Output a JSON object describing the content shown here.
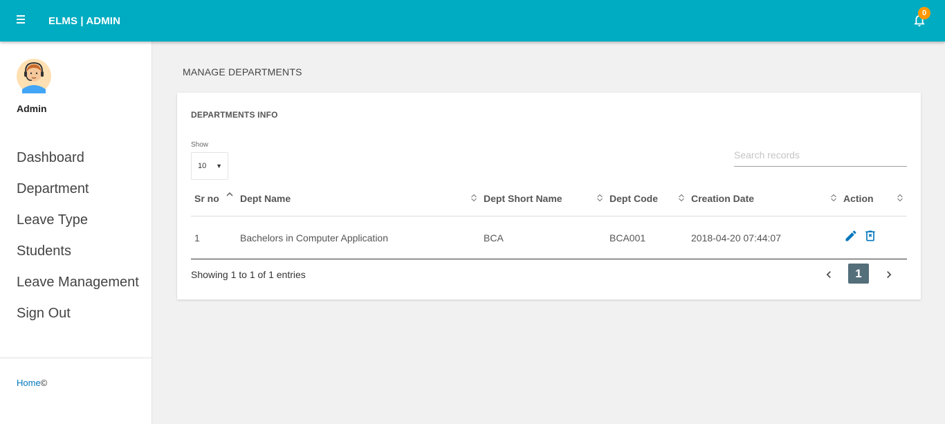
{
  "header": {
    "brand": "ELMS | ADMIN",
    "notification_count": "0"
  },
  "sidebar": {
    "user_name": "Admin",
    "items": [
      {
        "label": "Dashboard"
      },
      {
        "label": "Department"
      },
      {
        "label": "Leave Type"
      },
      {
        "label": "Students"
      },
      {
        "label": "Leave Management"
      },
      {
        "label": "Sign Out"
      }
    ],
    "footer_link": "Home",
    "footer_copy": "©"
  },
  "main": {
    "page_title": "MANAGE DEPARTMENTS",
    "card_title": "DEPARTMENTS INFO",
    "show_label": "Show",
    "page_size": "10",
    "search_placeholder": "Search records",
    "columns": [
      "Sr no",
      "Dept Name",
      "Dept Short Name",
      "Dept Code",
      "Creation Date",
      "Action"
    ],
    "rows": [
      {
        "sr": "1",
        "name": "Bachelors in Computer Application",
        "short": "BCA",
        "code": "BCA001",
        "date": "2018-04-20 07:44:07"
      }
    ],
    "entries_text": "Showing 1 to 1 of 1 entries",
    "current_page": "1"
  },
  "colors": {
    "topbar": "#00acc1",
    "badge": "#ff9800",
    "link": "#0277bd",
    "active_page": "#546e7a"
  }
}
